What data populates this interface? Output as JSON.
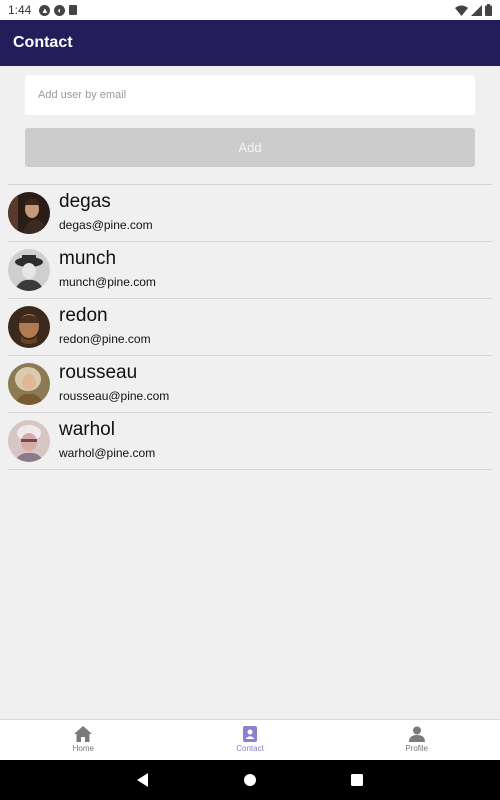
{
  "status_bar": {
    "time": "1:44"
  },
  "app_bar": {
    "title": "Contact"
  },
  "add_user": {
    "placeholder": "Add user by email",
    "button_label": "Add"
  },
  "contacts": [
    {
      "name": "degas",
      "email": "degas@pine.com",
      "avatar_icon": "portrait-degas"
    },
    {
      "name": "munch",
      "email": "munch@pine.com",
      "avatar_icon": "portrait-munch"
    },
    {
      "name": "redon",
      "email": "redon@pine.com",
      "avatar_icon": "portrait-redon"
    },
    {
      "name": "rousseau",
      "email": "rousseau@pine.com",
      "avatar_icon": "portrait-rousseau"
    },
    {
      "name": "warhol",
      "email": "warhol@pine.com",
      "avatar_icon": "portrait-warhol"
    }
  ],
  "bottom_nav": {
    "items": [
      {
        "label": "Home",
        "icon": "home-icon"
      },
      {
        "label": "Contact",
        "icon": "contact-book-icon",
        "active": true
      },
      {
        "label": "Profile",
        "icon": "person-icon"
      }
    ]
  },
  "colors": {
    "app_bar": "#241d5c",
    "active_nav": "#8f7fcf",
    "add_button": "#cccccc",
    "background": "#f0f0f0"
  }
}
